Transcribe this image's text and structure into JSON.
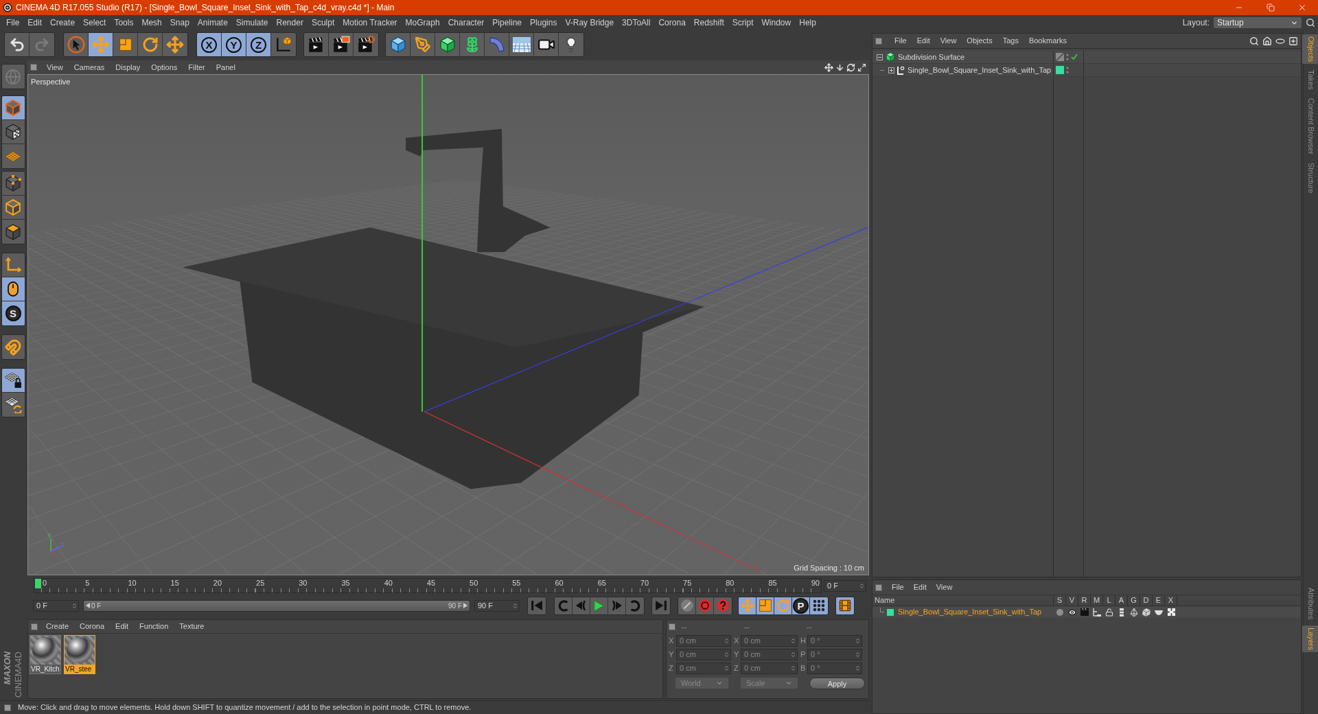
{
  "window": {
    "title": "CINEMA 4D R17.055 Studio (R17) - [Single_Bowl_Square_Inset_Sink_with_Tap_c4d_vray.c4d *] - Main"
  },
  "menu_bar": {
    "items": [
      "File",
      "Edit",
      "Create",
      "Select",
      "Tools",
      "Mesh",
      "Snap",
      "Animate",
      "Simulate",
      "Render",
      "Sculpt",
      "Motion Tracker",
      "MoGraph",
      "Character",
      "Pipeline",
      "Plugins",
      "V-Ray Bridge",
      "3DToAll",
      "Corona",
      "Redshift",
      "Script",
      "Window",
      "Help"
    ],
    "layout_label": "Layout:",
    "layout_value": "Startup"
  },
  "toolbar": [
    [
      {
        "kind": "undo",
        "disabled": false
      },
      {
        "kind": "redo",
        "disabled": true
      }
    ],
    [
      {
        "kind": "live-select",
        "active": false
      },
      {
        "kind": "move",
        "active": true
      },
      {
        "kind": "scale",
        "active": false
      },
      {
        "kind": "rotate",
        "active": false
      },
      {
        "kind": "transform",
        "active": false
      }
    ],
    [
      {
        "kind": "axis-lock",
        "label": "X",
        "active": true
      },
      {
        "kind": "axis-lock",
        "label": "Y",
        "active": true
      },
      {
        "kind": "axis-lock",
        "label": "Z",
        "active": true
      },
      {
        "kind": "coordinate-system",
        "active": false
      }
    ],
    [
      {
        "kind": "render-view"
      },
      {
        "kind": "render-picture-viewer"
      },
      {
        "kind": "render-settings"
      }
    ],
    [
      {
        "kind": "cube"
      },
      {
        "kind": "pen"
      },
      {
        "kind": "subdivision"
      },
      {
        "kind": "cloner"
      },
      {
        "kind": "bend"
      },
      {
        "kind": "floor"
      },
      {
        "kind": "camera"
      },
      {
        "kind": "light"
      }
    ]
  ],
  "left_toolbar": [
    [
      {
        "kind": "make-editable",
        "disabled": true
      }
    ],
    [
      {
        "kind": "model",
        "active": true
      },
      {
        "kind": "texture",
        "active": false
      },
      {
        "kind": "workplane",
        "active": false
      }
    ],
    [
      {
        "kind": "points",
        "active": false
      },
      {
        "kind": "edges",
        "active": false
      },
      {
        "kind": "polygons",
        "active": false
      }
    ],
    [
      {
        "kind": "axis",
        "active": false
      },
      {
        "kind": "tweak",
        "active": true
      },
      {
        "kind": "snap",
        "label": "S",
        "active": true
      }
    ],
    [
      {
        "kind": "magnet",
        "active": false
      }
    ],
    [
      {
        "kind": "workplane-lock",
        "active": true
      },
      {
        "kind": "workplane-align",
        "active": false
      }
    ]
  ],
  "logo": {
    "brand": "MAXON",
    "product": "CINEMA4D"
  },
  "viewport": {
    "menu": [
      "View",
      "Cameras",
      "Display",
      "Options",
      "Filter",
      "Panel"
    ],
    "camera": "Perspective",
    "grid_spacing": "Grid Spacing : 10 cm",
    "axis_labels": [
      "Y",
      "Z"
    ]
  },
  "timeline": {
    "labels": [
      "0",
      "5",
      "10",
      "15",
      "20",
      "25",
      "30",
      "35",
      "40",
      "45",
      "50",
      "55",
      "60",
      "65",
      "70",
      "75",
      "80",
      "85",
      "90"
    ],
    "current_frame": "0 F",
    "start": "0 F",
    "range": {
      "start": "0 F",
      "end": "90 F",
      "level": 1
    },
    "end": "90 F"
  },
  "playback": [
    [
      {
        "kind": "go-start"
      }
    ],
    [
      {
        "kind": "prev-frame"
      },
      {
        "kind": "prev-key"
      },
      {
        "kind": "play"
      },
      {
        "kind": "next-key"
      },
      {
        "kind": "next-frame"
      }
    ],
    [
      {
        "kind": "go-end"
      }
    ]
  ],
  "key_tools": [
    [
      {
        "kind": "key-off",
        "active": false
      },
      {
        "kind": "record",
        "active": false
      },
      {
        "kind": "autokey",
        "active": false
      }
    ],
    [
      {
        "kind": "key-position",
        "active": true
      },
      {
        "kind": "key-scale",
        "active": true
      },
      {
        "kind": "key-rotation",
        "active": true
      },
      {
        "kind": "key-parameter",
        "label": "P",
        "active": true
      },
      {
        "kind": "key-points",
        "active": true
      }
    ],
    [
      {
        "kind": "timeline-window",
        "active": true
      }
    ]
  ],
  "material_manager": {
    "menu": [
      "Create",
      "Corona",
      "Edit",
      "Function",
      "Texture"
    ],
    "materials": [
      {
        "name": "VR_Kitch",
        "selected": false
      },
      {
        "name": "VR_stee",
        "selected": true
      }
    ]
  },
  "coordinates": {
    "headers": [
      "--",
      "--",
      "--"
    ],
    "rows": [
      {
        "position_axis": "X",
        "position": "0 cm",
        "size_axis": "X",
        "size": "0 cm",
        "rotation_axis": "H",
        "rotation": "0 °"
      },
      {
        "position_axis": "Y",
        "position": "0 cm",
        "size_axis": "Y",
        "size": "0 cm",
        "rotation_axis": "P",
        "rotation": "0 °"
      },
      {
        "position_axis": "Z",
        "position": "0 cm",
        "size_axis": "Z",
        "size": "0 cm",
        "rotation_axis": "B",
        "rotation": "0 °"
      }
    ],
    "mode": "World",
    "size_mode": "Scale",
    "apply": "Apply"
  },
  "status_bar": "Move: Click and drag to move elements. Hold down SHIFT to quantize movement / add to the selection in point mode, CTRL to remove.",
  "object_manager": {
    "menu": [
      "File",
      "Edit",
      "View",
      "Objects",
      "Tags",
      "Bookmarks"
    ],
    "objects": [
      {
        "name": "Subdivision Surface",
        "kind": "subdivision",
        "expanded": true,
        "checked": true,
        "children": [
          {
            "name": "Single_Bowl_Square_Inset_Sink_with_Tap",
            "kind": "null",
            "expanded": false,
            "color": "#33e0a0"
          }
        ]
      }
    ]
  },
  "layer_manager": {
    "menu": [
      "File",
      "Edit",
      "View"
    ],
    "columns": [
      "Name",
      "S",
      "V",
      "R",
      "M",
      "L",
      "A",
      "G",
      "D",
      "E",
      "X"
    ],
    "layers": [
      {
        "name": "Single_Bowl_Square_Inset_Sink_with_Tap",
        "color": "#33e0a0",
        "selected": true
      }
    ]
  },
  "side_tabs": {
    "top": [
      {
        "label": "Objects",
        "selected": true
      },
      {
        "label": "Takes",
        "selected": false
      },
      {
        "label": "Content Browser",
        "selected": false
      },
      {
        "label": "Structure",
        "selected": false
      }
    ],
    "bottom": [
      {
        "label": "Attributes",
        "selected": false
      },
      {
        "label": "Layers",
        "selected": true
      }
    ]
  }
}
